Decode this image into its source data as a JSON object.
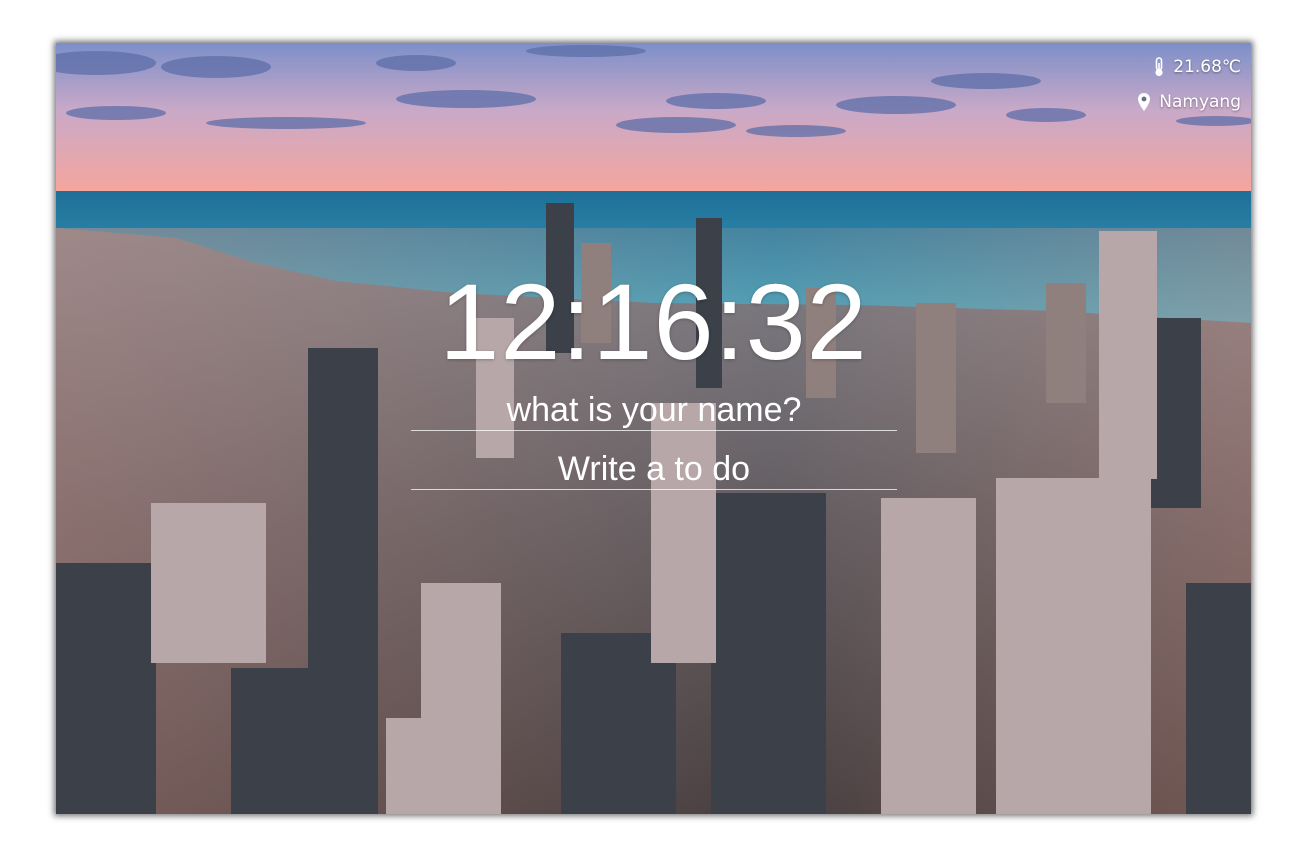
{
  "weather": {
    "temperature": "21.68℃",
    "location": "Namyang",
    "temperature_icon": "thermometer-icon",
    "location_icon": "location-pin-icon"
  },
  "clock": {
    "time": "12:16:32"
  },
  "name_input": {
    "placeholder": "what is your name?",
    "value": ""
  },
  "todo_input": {
    "placeholder": "Write a to do",
    "value": ""
  },
  "colors": {
    "text": "#ffffff",
    "sky_top": "#7d8ec8",
    "sky_bottom": "#f3a6a0",
    "sea": "#2c8fb2"
  }
}
